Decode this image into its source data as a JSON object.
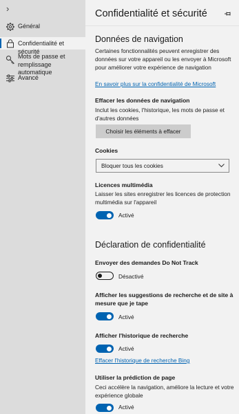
{
  "sidebar": {
    "expand_glyph": "›",
    "items": [
      {
        "label": "Général",
        "icon": "gear-icon"
      },
      {
        "label": "Confidentialité et sécurité",
        "icon": "lock-icon"
      },
      {
        "label": "Mots de passe et remplissage automatique",
        "icon": "key-icon"
      },
      {
        "label": "Avancé",
        "icon": "sliders-icon"
      }
    ],
    "selected_index": 1
  },
  "main": {
    "title": "Confidentialité et sécurité",
    "pin_icon": "pin-icon",
    "browsing": {
      "heading": "Données de navigation",
      "description": "Certaines fonctionnalités peuvent enregistrer des données sur votre appareil ou les envoyer à Microsoft pour améliorer votre expérience de navigation",
      "learn_more_link": "En savoir plus sur la confidentialité de Microsoft",
      "clear": {
        "label": "Effacer les données de navigation",
        "description": "Inclut les cookies, l'historique, les mots de passe et d'autres données",
        "button": "Choisir les éléments à effacer"
      },
      "cookies": {
        "label": "Cookies",
        "selected": "Bloquer tous les cookies"
      },
      "media_licenses": {
        "label": "Licences multimédia",
        "description": "Laisser les sites enregistrer les licences de protection multimédia sur l'appareil",
        "state": "Activé",
        "on": true
      }
    },
    "privacy": {
      "heading": "Déclaration de confidentialité",
      "dnt": {
        "label": "Envoyer des demandes Do Not Track",
        "state": "Désactivé",
        "on": false
      },
      "suggestions": {
        "label": "Afficher les suggestions de recherche et de site à mesure que je tape",
        "state": "Activé",
        "on": true
      },
      "history": {
        "label": "Afficher l'historique de recherche",
        "state": "Activé",
        "on": true,
        "link": "Effacer l'historique de recherche Bing"
      },
      "prediction": {
        "label": "Utiliser la prédiction de page",
        "description": "Ceci accélère la navigation, améliore la lecture et votre expérience globale",
        "state": "Activé",
        "on": true
      }
    }
  },
  "colors": {
    "accent": "#0063b1",
    "sidebar_bg": "#dcdcdc",
    "panel_bg": "#f2f2f2"
  }
}
